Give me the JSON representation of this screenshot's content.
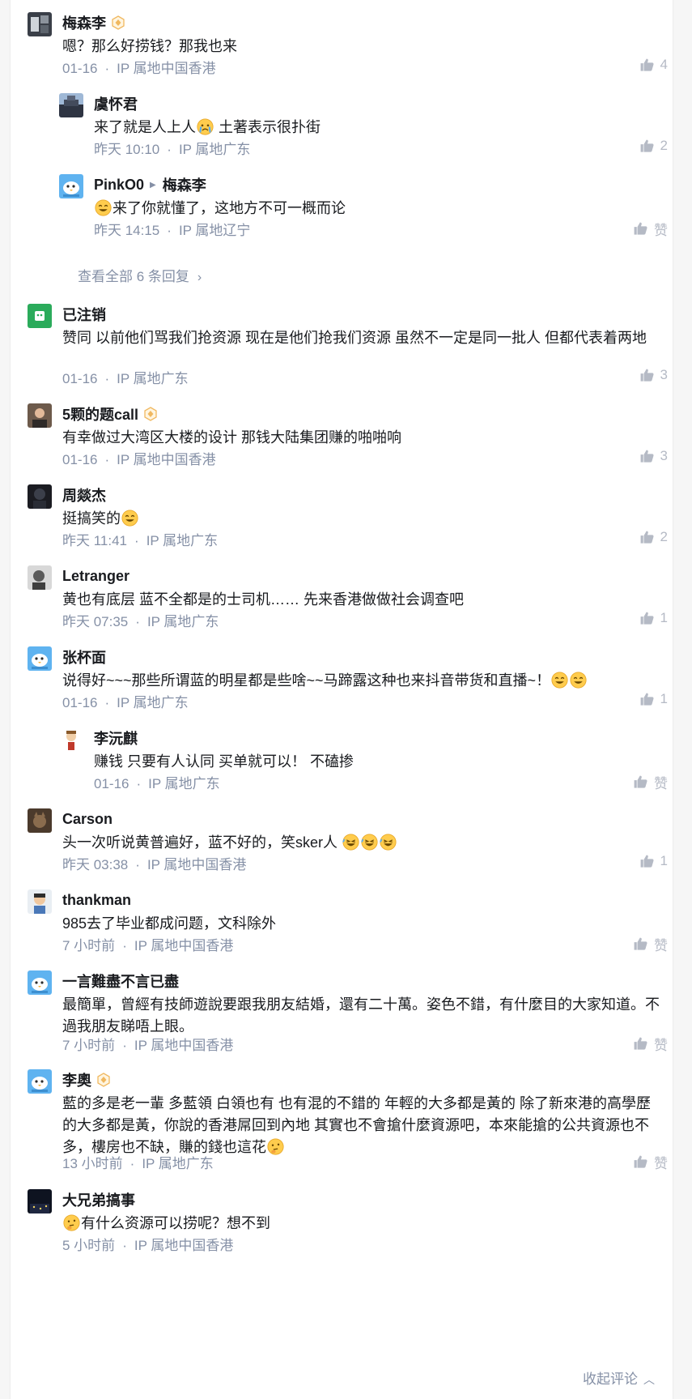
{
  "comments": [
    {
      "author": "梅森李",
      "badge": true,
      "text": "嗯？那么好捞钱？那我也来",
      "date": "01-16",
      "ip": "IP 属地中国香港",
      "likes": "4",
      "avatar": "photo-dark",
      "nested": false
    },
    {
      "author": "虞怀君",
      "text": "来了就是人上人",
      "emoji_after": "crying-face",
      "text_tail": " 土著表示很扑街",
      "date": "昨天 10:10",
      "ip": "IP 属地广东",
      "likes": "2",
      "avatar": "building-photo",
      "nested": true
    },
    {
      "author": "PinkO0",
      "reply_to": "梅森李",
      "emoji_before": "smiling-face",
      "text": "来了你就懂了，这地方不可一概而论",
      "date": "昨天 14:15",
      "ip": "IP 属地辽宁",
      "likes": "赞",
      "avatar": "default-bird",
      "nested": true
    },
    {
      "author": "已注销",
      "text": "赞同 以前他们骂我们抢资源 现在是他们抢我们资源 虽然不一定是同一批人 但都代表着两地",
      "date": "01-16",
      "ip": "IP 属地广东",
      "likes": "3",
      "avatar": "green-icon",
      "nested": false
    },
    {
      "author": "5颗的题call",
      "badge": true,
      "text": "有幸做过大湾区大楼的设计 那钱大陆集团赚的啪啪响",
      "date": "01-16",
      "ip": "IP 属地中国香港",
      "likes": "3",
      "avatar": "person-photo",
      "nested": false
    },
    {
      "author": "周燚杰",
      "text": "挺搞笑的",
      "emoji_after": "smiling-face",
      "date": "昨天 11:41",
      "ip": "IP 属地广东",
      "likes": "2",
      "avatar": "dark-figure",
      "nested": false
    },
    {
      "author": "Letranger",
      "text": "黄也有底层 蓝不全都是的士司机…… 先来香港做做社会调查吧",
      "date": "昨天 07:35",
      "ip": "IP 属地广东",
      "likes": "1",
      "avatar": "portrait-bw",
      "nested": false
    },
    {
      "author": "张杯面",
      "text": "说得好~~~那些所谓蓝的明星都是些啥~~马蹄露这种也来抖音带货和直播~！",
      "emoji_after": "smiling-face",
      "emoji_count": 2,
      "date": "01-16",
      "ip": "IP 属地广东",
      "likes": "1",
      "avatar": "default-bird",
      "nested": false
    },
    {
      "author": "李沅麒",
      "text": "赚钱 只要有人认同 买单就可以！ 不磕掺",
      "date": "01-16",
      "ip": "IP 属地广东",
      "likes": "赞",
      "avatar": "cartoon-figure",
      "nested": true
    },
    {
      "author": "Carson",
      "text": "头一次听说黄普遍好，蓝不好的，笑sker人 ",
      "emoji_after": "rolling-laugh",
      "emoji_count": 3,
      "date": "昨天 03:38",
      "ip": "IP 属地中国香港",
      "likes": "1",
      "avatar": "cat-photo",
      "nested": false
    },
    {
      "author": "thankman",
      "text": "985去了毕业都成问题，文科除外",
      "date": "7 小时前",
      "ip": "IP 属地中国香港",
      "likes": "赞",
      "avatar": "person-cartoon",
      "nested": false
    },
    {
      "author": "一言難盡不言已盡",
      "text": "最簡單，曾經有技師遊說要跟我朋友結婚，還有二十萬。姿色不錯，有什麼目的大家知道。不過我朋友睇唔上眼。",
      "date": "7 小时前",
      "ip": "IP 属地中国香港",
      "likes": "赞",
      "avatar": "default-bird",
      "nested": false
    },
    {
      "author": "李奧",
      "badge": true,
      "text": "藍的多是老一輩 多藍領 白領也有 也有混的不錯的 年輕的大多都是黃的 除了新來港的高學歷的大多都是黃，你說的香港屌回到內地 其實也不會搶什麼資源吧，本來能搶的公共資源也不多，樓房也不缺，賺的錢也這花",
      "emoji_after": "thinking-face",
      "date": "13 小时前",
      "ip": "IP 属地广东",
      "likes": "赞",
      "avatar": "default-bird",
      "nested": false
    },
    {
      "author": "大兄弟搞事",
      "emoji_before": "thinking-face",
      "text": "有什么资源可以捞呢？想不到",
      "date": "5 小时前",
      "ip": "IP 属地中国香港",
      "likes": "",
      "avatar": "night-photo",
      "nested": false
    }
  ],
  "view_all_replies": "查看全部 6 条回复",
  "collapse_label": "收起评论",
  "colors": {
    "accent": "#056de8",
    "meta": "#8590a6",
    "like_icon": "#b5bac5",
    "badge": "#f0b860"
  }
}
